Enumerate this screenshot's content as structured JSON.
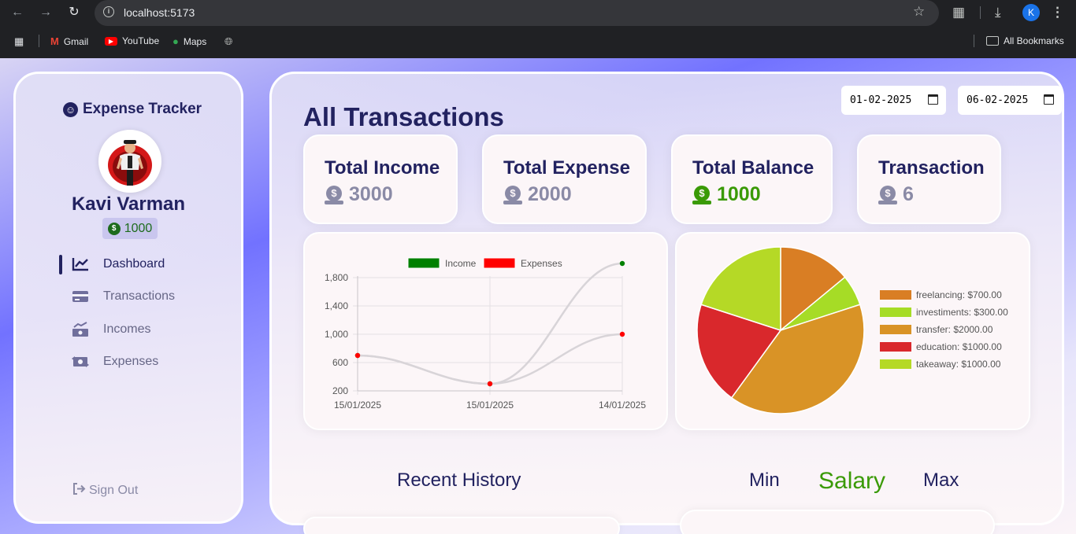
{
  "browser": {
    "url": "localhost:5173",
    "profile_initial": "K",
    "bookmarks": [
      "Gmail",
      "YouTube",
      "Maps"
    ],
    "all_bookmarks": "All Bookmarks"
  },
  "sidebar": {
    "brand": "Expense Tracker",
    "user_name": "Kavi Varman",
    "user_balance": "1000",
    "menu": [
      {
        "label": "Dashboard",
        "icon": "chart-line-icon"
      },
      {
        "label": "Transactions",
        "icon": "credit-card-icon"
      },
      {
        "label": "Incomes",
        "icon": "money-bill-trend-icon"
      },
      {
        "label": "Expenses",
        "icon": "money-bill-transfer-icon"
      }
    ],
    "sign_out": "Sign Out"
  },
  "main": {
    "title": "All Transactions",
    "date_from": "01-02-2025",
    "date_to": "06-02-2025",
    "stats": [
      {
        "title": "Total Income",
        "value": "3000"
      },
      {
        "title": "Total Expense",
        "value": "2000"
      },
      {
        "title": "Total Balance",
        "value": "1000"
      },
      {
        "title": "Transaction",
        "value": "6"
      }
    ],
    "recent_history": "Recent History",
    "min_label": "Min",
    "salary_label": "Salary",
    "max_label": "Max"
  },
  "colors": {
    "navy": "#222260",
    "green": "#3a9a06",
    "muted": "#8a8aa6",
    "income": "#008000",
    "expense": "#ff0000"
  },
  "chart_data": [
    {
      "type": "line",
      "x": [
        "15/01/2025",
        "15/01/2025",
        "14/01/2025"
      ],
      "series": [
        {
          "name": "Income",
          "values": [
            700,
            300,
            2000
          ],
          "color": "#008000"
        },
        {
          "name": "Expenses",
          "values": [
            700,
            300,
            1000
          ],
          "color": "#ff0000"
        }
      ],
      "yticks": [
        "200",
        "600",
        "1,000",
        "1,400",
        "1,800"
      ],
      "ylim": [
        200,
        2000
      ],
      "legend": "top",
      "grid": true
    },
    {
      "type": "pie",
      "slices": [
        {
          "label": "freelancing: $700.00",
          "value": 700,
          "color": "#d97e24"
        },
        {
          "label": "investiments: $300.00",
          "value": 300,
          "color": "#a6dc26"
        },
        {
          "label": "transfer: $2000.00",
          "value": 2000,
          "color": "#d99326"
        },
        {
          "label": "education: $1000.00",
          "value": 1000,
          "color": "#d9282c"
        },
        {
          "label": "takeaway: $1000.00",
          "value": 1000,
          "color": "#b5d926"
        }
      ],
      "legend": "right"
    }
  ]
}
